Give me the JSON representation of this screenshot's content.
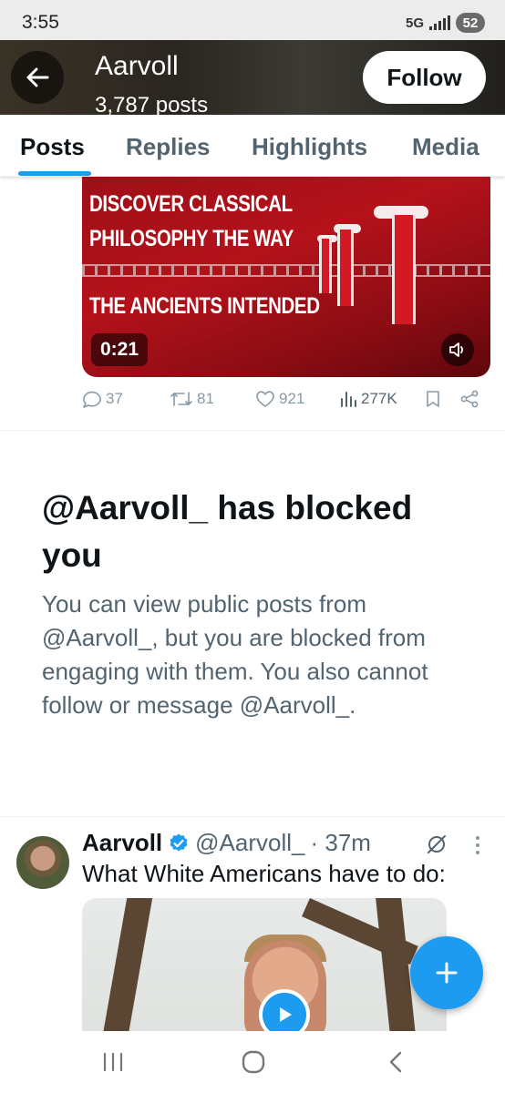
{
  "status_bar": {
    "time": "3:55",
    "network": "5G",
    "battery": "52"
  },
  "header": {
    "name": "Aarvoll",
    "posts_count": "3,787 posts",
    "follow_label": "Follow"
  },
  "tabs": [
    {
      "label": "Posts",
      "active": true
    },
    {
      "label": "Replies",
      "active": false
    },
    {
      "label": "Highlights",
      "active": false
    },
    {
      "label": "Media",
      "active": false
    }
  ],
  "video_post": {
    "overlay_lines": [
      "DISCOVER CLASSICAL",
      "PHILOSOPHY THE WAY",
      "THE ANCIENTS INTENDED"
    ],
    "duration": "0:21",
    "stats": {
      "replies": "37",
      "reposts": "81",
      "likes": "921",
      "views": "277K"
    }
  },
  "blocked_notice": {
    "title": "@Aarvoll_ has blocked you",
    "body": "You can view public posts from @Aarvoll_, but you are blocked from engaging with them. You also cannot follow or message @Aarvoll_."
  },
  "post": {
    "author_name": "Aarvoll",
    "handle": "@Aarvoll_",
    "time": "· 37m",
    "text": "What White Americans have to do:"
  },
  "colors": {
    "accent": "#1d9bf0",
    "secondary_text": "#536471",
    "primary_text": "#0f1419"
  }
}
